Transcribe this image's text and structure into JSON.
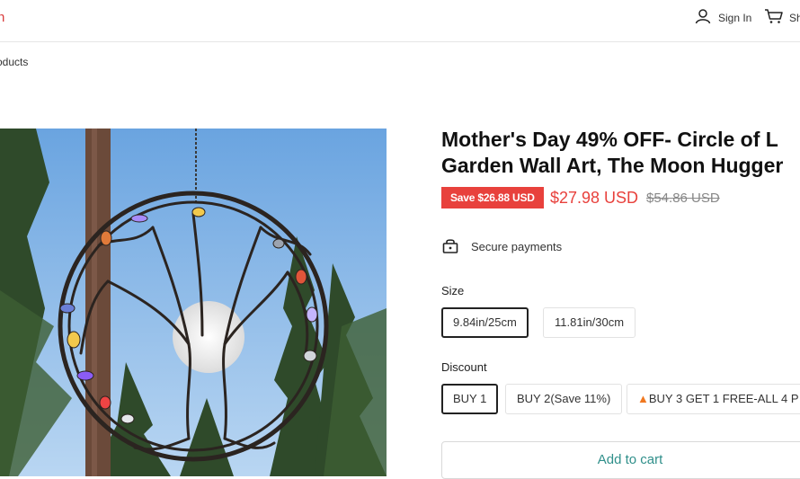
{
  "header": {
    "logo_fragment": "n",
    "signin_label": "Sign In",
    "cart_label": "Sh"
  },
  "breadcrumb": "roducts",
  "product": {
    "title_line1": "Mother's Day 49% OFF- Circle of L",
    "title_line2": "Garden Wall Art, The Moon Hugger",
    "save_badge": "Save $26.88 USD",
    "price": "$27.98 USD",
    "compare_price": "$54.86 USD",
    "secure_label": "Secure payments"
  },
  "size": {
    "label": "Size",
    "options": [
      "9.84in/25cm",
      "11.81in/30cm"
    ],
    "selected": 0
  },
  "discount": {
    "label": "Discount",
    "options": [
      "BUY 1",
      "BUY 2(Save 11%)",
      "BUY 3 GET 1 FREE-ALL 4 P"
    ],
    "selected": 0
  },
  "add_to_cart": "Add to cart",
  "colors": {
    "sale": "#e8413c",
    "cart_button_text": "#2f8f8a",
    "sky": "#7fb2e6"
  }
}
